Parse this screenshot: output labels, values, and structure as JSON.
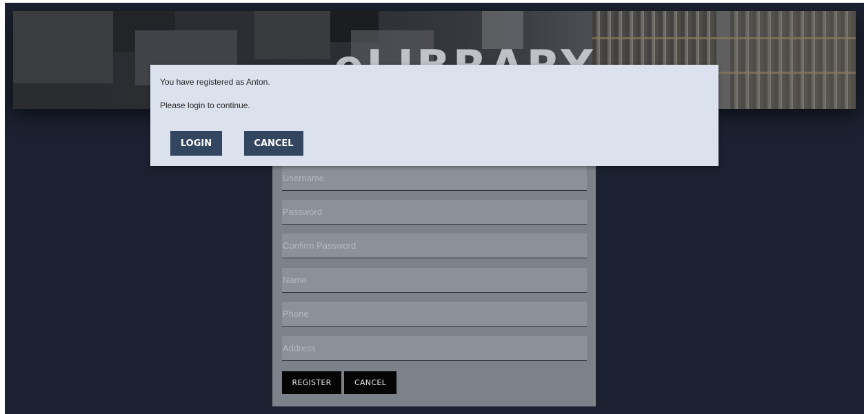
{
  "banner": {
    "title": "eLIBRARY"
  },
  "dialog": {
    "message_line1": "You have registered as Anton.",
    "message_line2": "Please login to continue.",
    "login_label": "LOGIN",
    "cancel_label": "CANCEL"
  },
  "register_form": {
    "fields": [
      {
        "placeholder": "Username",
        "value": ""
      },
      {
        "placeholder": "Password",
        "value": ""
      },
      {
        "placeholder": "Confirm Password",
        "value": ""
      },
      {
        "placeholder": "Name",
        "value": ""
      },
      {
        "placeholder": "Phone",
        "value": ""
      },
      {
        "placeholder": "Address",
        "value": ""
      }
    ],
    "register_label": "REGISTER",
    "cancel_label": "CANCEL"
  },
  "colors": {
    "page_background": "#1b2130",
    "form_panel": "#7d828a",
    "dialog_background": "#dbe2ee",
    "dialog_button": "#334660",
    "form_button": "#050505"
  }
}
